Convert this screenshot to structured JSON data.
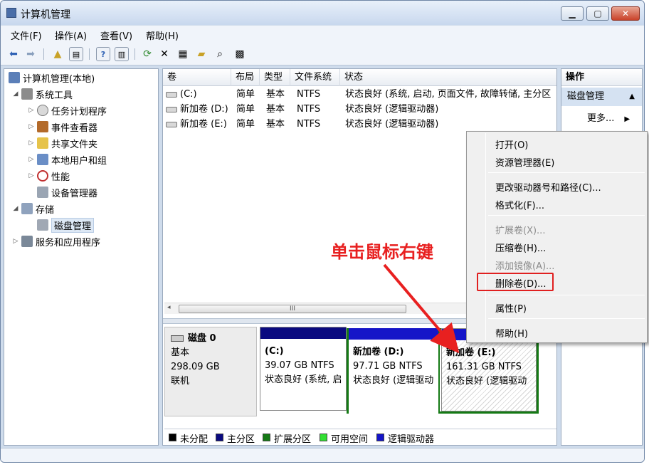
{
  "window": {
    "title": "计算机管理",
    "buttons": {
      "minimize": "▁",
      "maximize": "▢",
      "close": "✕"
    }
  },
  "menu": [
    "文件(F)",
    "操作(A)",
    "查看(V)",
    "帮助(H)"
  ],
  "toolbar_icons": [
    "back-arrow-icon",
    "forward-arrow-icon",
    "up-folder-icon",
    "show-hide-tree-icon",
    "help-icon",
    "show-hide-action-icon",
    "refresh-icon",
    "delete-icon",
    "properties-icon",
    "open-icon",
    "search-icon",
    "settings-icon"
  ],
  "tree": {
    "root": "计算机管理(本地)",
    "items": [
      {
        "label": "系统工具",
        "level": 1,
        "expander": "◢"
      },
      {
        "label": "任务计划程序",
        "level": 2,
        "expander": "▷"
      },
      {
        "label": "事件查看器",
        "level": 2,
        "expander": "▷"
      },
      {
        "label": "共享文件夹",
        "level": 2,
        "expander": "▷"
      },
      {
        "label": "本地用户和组",
        "level": 2,
        "expander": "▷"
      },
      {
        "label": "性能",
        "level": 2,
        "expander": "▷"
      },
      {
        "label": "设备管理器",
        "level": 2,
        "expander": ""
      },
      {
        "label": "存储",
        "level": 1,
        "expander": "◢"
      },
      {
        "label": "磁盘管理",
        "level": 2,
        "expander": "",
        "selected": true
      },
      {
        "label": "服务和应用程序",
        "level": 1,
        "expander": "▷"
      }
    ]
  },
  "volume_list": {
    "columns": [
      "卷",
      "布局",
      "类型",
      "文件系统",
      "状态"
    ],
    "rows": [
      {
        "volume": "(C:)",
        "layout": "简单",
        "type": "基本",
        "fs": "NTFS",
        "status": "状态良好 (系统, 启动, 页面文件, 故障转储, 主分区"
      },
      {
        "volume": "新加卷 (D:)",
        "layout": "简单",
        "type": "基本",
        "fs": "NTFS",
        "status": "状态良好 (逻辑驱动器)"
      },
      {
        "volume": "新加卷 (E:)",
        "layout": "简单",
        "type": "基本",
        "fs": "NTFS",
        "status": "状态良好 (逻辑驱动器)"
      }
    ],
    "scroll_label": "III",
    "scroll_left": "◂",
    "scroll_right": "▸"
  },
  "disk": {
    "name": "磁盘 0",
    "type": "基本",
    "size": "298.09 GB",
    "state": "联机",
    "partitions": [
      {
        "name": "(C:)",
        "size": "39.07 GB NTFS",
        "status": "状态良好 (系统, 启"
      },
      {
        "name": "新加卷 (D:)",
        "size": "97.71 GB NTFS",
        "status": "状态良好 (逻辑驱动"
      },
      {
        "name": "新加卷 (E:)",
        "size": "161.31 GB NTFS",
        "status": "状态良好 (逻辑驱动"
      }
    ]
  },
  "legend": [
    {
      "label": "未分配",
      "color": "#000000"
    },
    {
      "label": "主分区",
      "color": "#0a0a80"
    },
    {
      "label": "扩展分区",
      "color": "#157a15"
    },
    {
      "label": "可用空间",
      "color": "#33e033"
    },
    {
      "label": "逻辑驱动器",
      "color": "#1515c8"
    }
  ],
  "actions": {
    "header": "操作",
    "group": "磁盘管理",
    "group_caret": "▲",
    "more": "更多...",
    "more_caret": "▶"
  },
  "context_menu": {
    "items": [
      {
        "label": "打开(O)",
        "disabled": false
      },
      {
        "label": "资源管理器(E)",
        "disabled": false
      },
      {
        "label": "更改驱动器号和路径(C)...",
        "disabled": false
      },
      {
        "label": "格式化(F)...",
        "disabled": false
      },
      {
        "label": "扩展卷(X)...",
        "disabled": true
      },
      {
        "label": "压缩卷(H)...",
        "disabled": false
      },
      {
        "label": "添加镜像(A)...",
        "disabled": true
      },
      {
        "label": "删除卷(D)...",
        "disabled": false,
        "highlighted": true
      },
      {
        "label": "属性(P)",
        "disabled": false
      },
      {
        "label": "帮助(H)",
        "disabled": false
      }
    ]
  },
  "annotation": {
    "text": "单击鼠标右键",
    "color": "#e82020"
  }
}
